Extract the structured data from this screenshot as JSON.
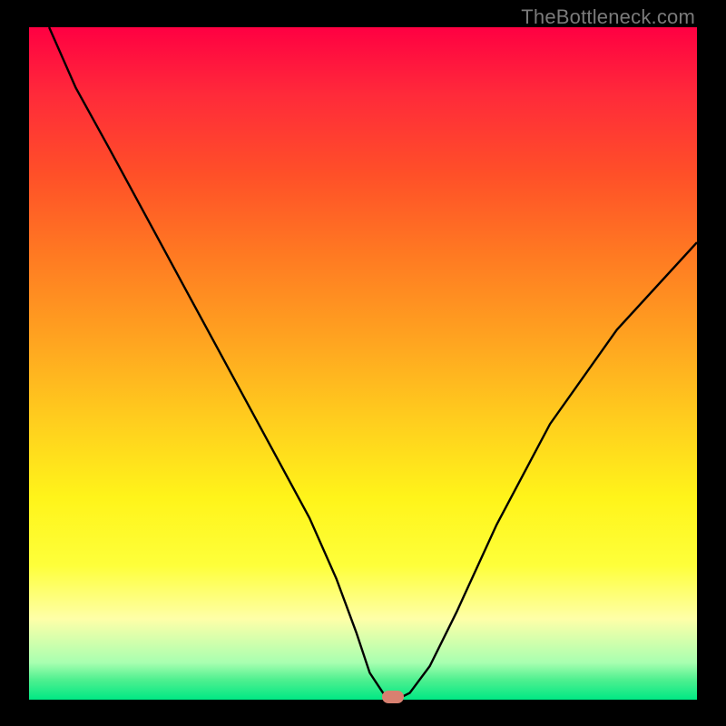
{
  "watermark": "TheBottleneck.com",
  "chart_data": {
    "type": "line",
    "title": "",
    "xlabel": "",
    "ylabel": "",
    "xlim": [
      0,
      100
    ],
    "ylim": [
      0,
      100
    ],
    "series": [
      {
        "name": "curve",
        "x": [
          3,
          7,
          12,
          18,
          24,
          30,
          36,
          42,
          46,
          49,
          51,
          53,
          55,
          57,
          60,
          64,
          70,
          78,
          88,
          100
        ],
        "values": [
          100,
          91,
          82,
          71,
          60,
          49,
          38,
          27,
          18,
          10,
          4,
          1,
          0,
          1,
          5,
          13,
          26,
          41,
          55,
          68
        ]
      }
    ],
    "marker": {
      "x": 54.5,
      "y": 0
    },
    "grid": false,
    "legend": false
  }
}
